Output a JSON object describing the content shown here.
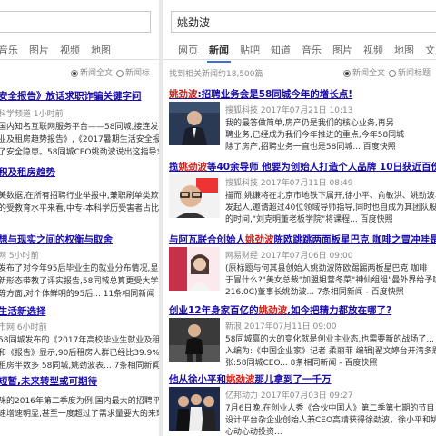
{
  "left": {
    "tabs": [
      "音乐",
      "图片",
      "视频",
      "地图"
    ],
    "options": [
      "新闻全文",
      "新闻标"
    ],
    "results": [
      {
        "title_a": "安全报告》放话求职诈骗关键字问",
        "lines": [
          "科学频道  1小时前",
          "国内知名互联网服务平台——58同城,接连发布《",
          "业及租房趋势报告》,《2017暑期生活安全报告",
          "了安全隐患。58同城CEO姚劲波说出这指导求..."
        ],
        "extra": "4条相同新闻"
      },
      {
        "title_a": "积及租房趋势",
        "lines": [
          "美数据,在所有招聘行业举报中,兼职刷单类欺诈",
          "的受教育水平来看,中专-本科学历受害者占比..."
        ],
        "extra": ""
      },
      {
        "title_a": "想与现实之间的权衡与取舍",
        "lines": [
          "网  5小时前",
          "发布了对今年95后毕业生的就业分布情况,显示",
          "新形态带教了评实报告,58同城总算更受大学生",
          "等方面,对个体鲜明的95后... 11条相同新闻"
        ],
        "extra": ""
      },
      {
        "title_a": "生活新选择",
        "lines": [
          "市网  6小时前",
          "58同城发布的《2017年高校毕业生就业及租",
          "和《报告》显示,90后租房人群已经比39.9%",
          "租房半数多 58同城,姚劲波表... 7条相同新闻"
        ],
        "extra": ""
      },
      {
        "title_a": "短暂,未来转型或可期待",
        "lines": [
          "咪的2016年第二季度为例,国内最大的招聘平台",
          "速增速明显,甚至一度超过了需求量要大的来现来"
        ],
        "extra": ""
      }
    ]
  },
  "right": {
    "query": "姚劲波",
    "tabs": [
      "网页",
      "新闻",
      "贴吧",
      "知道",
      "音乐",
      "图片",
      "视频",
      "地图",
      "文库"
    ],
    "active_tab": "新闻",
    "count_text": "找到相关新闻约18,500篇",
    "options": [
      "新闻全文",
      "新闻标题"
    ],
    "results": [
      {
        "title_pre": "",
        "title_hl": "姚劲波",
        "title_post": ":招聘业务会是58同城今年的增长点!",
        "src": "搜狐科技  2017年07月21日  10:13",
        "lines": [
          "我的最答做简单,房产仍是我们的核心业务,再另",
          "聘业务,已经成为我们今年推进的重点,今年58同城",
          "除了房产,招聘业务一直也是58同城... 百度快照"
        ],
        "thumb": "suit"
      },
      {
        "title_pre": "揽",
        "title_hl": "姚劲波",
        "title_post": "等40余导师 他要为创始人打造个人品牌 10日获近百份报名...",
        "src": "搜狐科技  2017年07月11日  08:49",
        "lines": [
          "描而,姚谦将在北京市地铁下属开,徐小平、俞敏洪、姚劲波、",
          "发起人,邀请超过40位领域导师指导,同时也自成为其团队股东人",
          "的时间,\"刘克明董老板学院\"将课程... 百度快照"
        ],
        "thumb": "glasses"
      },
      {
        "title_pre": "与阿瓦联合创始人",
        "title_hl": "姚劲波",
        "title_post": "陈欧跳跳两面板星巴克 咖啡之冒冲哇是什么?",
        "src": "网易财经  2017年07月06日  09:00",
        "lines": [
          "(原标题与何其县创始人姚劲波陈欧踢踢两板星巴克 咖啡",
          "于冒什么?\"美女总裁\"加盟姐营冬菜\"神仙组组\"曼外界给予咖",
          "216.0C)董事长姚劲波... 7条相同新闻 - 百度快照"
        ],
        "thumb": "woman"
      },
      {
        "title_pre": "创业12年身家百亿的",
        "title_hl": "姚劲波",
        "title_post": ",如今把精力都放在哪了?",
        "src": "新浪  2017年07月11日  09:00",
        "lines": [
          "58同城赢的大的变化就是创业主业态,也需要新的战场了...",
          "入编为:《中国企业家》记者 柔丽菲  编辑|翟文婷台开湾多题",
          "张:58同城CEO... 8条相同新闻 - 百度快照"
        ],
        "thumb": "casual"
      },
      {
        "title_pre": "他从徐小平和",
        "title_hl": "姚劲波",
        "title_post": "那儿拿到了一千万",
        "src": "亿邦动力  2017年07月03日  09:27",
        "lines": [
          "7月6日晚,在创业人秀《合伙中国人》第二季第七期的节目",
          "设计平台杂企业创始人兼CEO高靖获得徐劲波、徐小平和姚",
          "心动心动投资..."
        ],
        "thumb": "group"
      }
    ]
  },
  "colors": {
    "link": "#1a0dab",
    "highlight": "#d0201a",
    "accent": "#3b6fd6"
  }
}
